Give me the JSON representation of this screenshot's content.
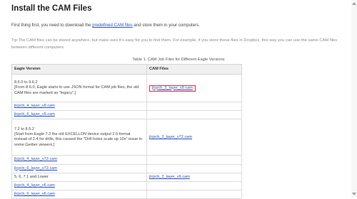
{
  "page": {
    "title": "Install the CAM Files",
    "intro_before": "First thing first, you need to download the ",
    "intro_link": "predefined CAM files",
    "intro_after": " and store them in your computers.",
    "tip": "Tip:The CAM files can be stored anywhere, but make sure it's easy for you to find them. For example, if you store these files in Dropbox, this way you can use the same CAM files between different computers."
  },
  "table": {
    "caption": "Table 1. CAM Job Files for Different Eagle Versions",
    "header_version": "Eagle Version",
    "header_cam": "CAM Files",
    "groups": [
      {
        "version_title": "8.6.0 to 9.6.2",
        "version_note": "[From 8.6.0, Eagle starts to use JSON format for CAM job files, the old CAM files are marked as \"legacy\".]",
        "cam_file": "jlcpcb_2_layer_v9.cam",
        "links": [
          "jlcpcb_4_layer_v9.cam",
          "jlcpcb_6_layer_v9.cam"
        ]
      },
      {
        "version_title": "7.2 to 8.5.2",
        "version_note": "[Start from Eagle 7.2 the old EXCELLON device output 2.5 format instead of 2.4 for drills, this caused the \"Drill holes scale up 10x\" issue in some Gerber viewers.]",
        "cam_file": "jlcpcb_2_layer_v72.cam",
        "links": [
          "jlcpcb_4_layer_v72.cam",
          "jlcpcb_6_layer_v72.cam"
        ]
      },
      {
        "version_title": "5, 6, 7.1 and Lower",
        "version_note": "",
        "cam_file": "jlcpcb_2_layer_v6.cam",
        "links": [
          "jlcpcb_4_layer_v6.cam",
          "jlcpcb_6_layer_v6.cam"
        ]
      }
    ]
  },
  "colors": {
    "link": "#2a52be",
    "highlight_border": "#d9302c",
    "header_bg": "#f0f0f0"
  }
}
